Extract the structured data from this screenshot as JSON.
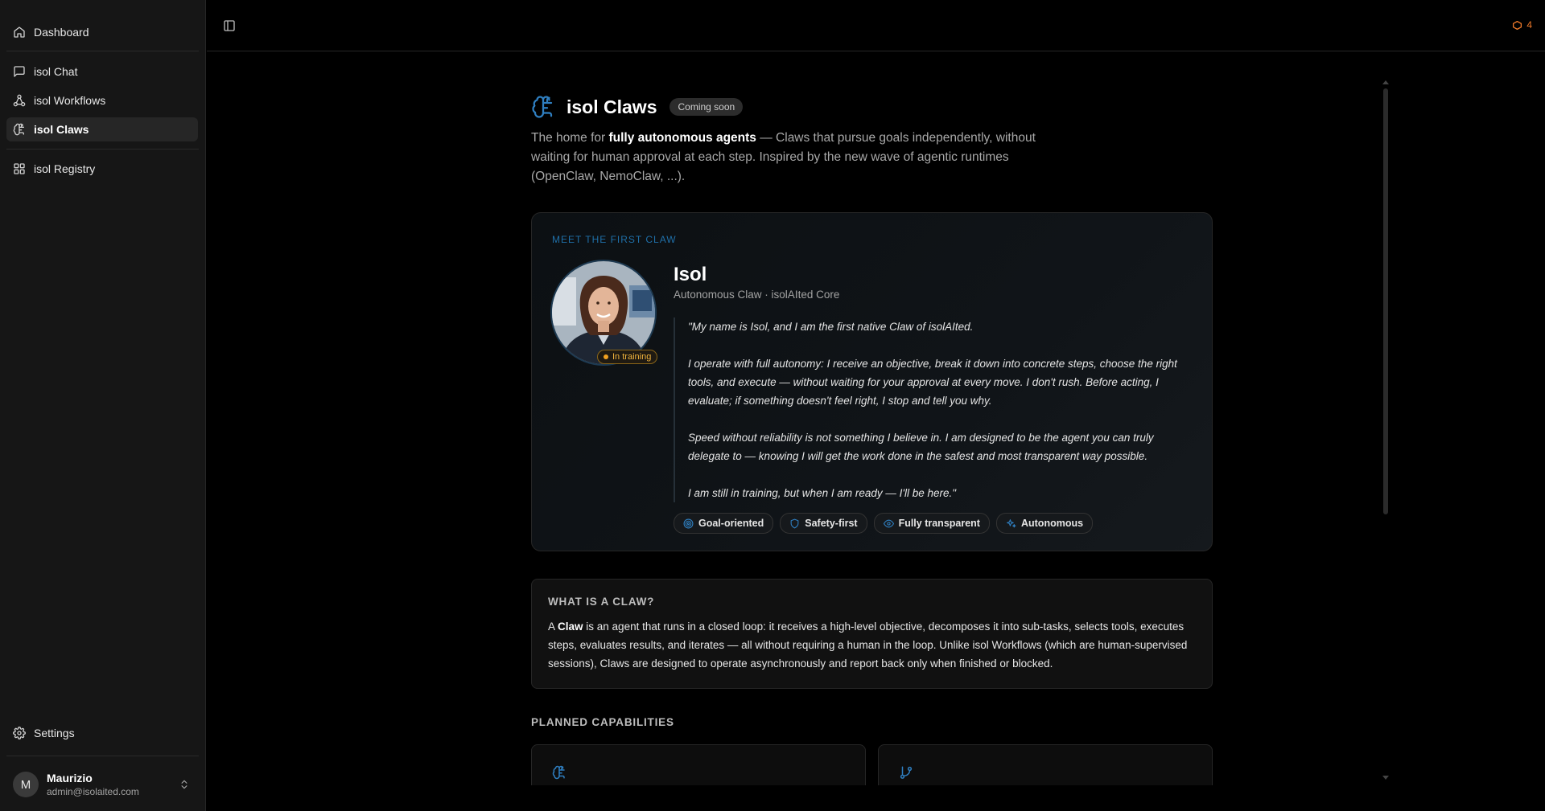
{
  "sidebar": {
    "items": [
      {
        "label": "Dashboard",
        "icon": "home-icon"
      },
      {
        "label": "isol Chat",
        "icon": "chat-icon"
      },
      {
        "label": "isol Workflows",
        "icon": "workflow-icon"
      },
      {
        "label": "isol Claws",
        "icon": "claw-icon",
        "active": true
      },
      {
        "label": "isol Registry",
        "icon": "grid-icon"
      }
    ],
    "settings_label": "Settings",
    "user": {
      "initial": "M",
      "name": "Maurizio",
      "email": "admin@isolaited.com"
    }
  },
  "topbar": {
    "alert_count": "4",
    "alert_color": "#f07a2a"
  },
  "page": {
    "title": "isol Claws",
    "badge": "Coming soon",
    "intro_prefix": "The home for ",
    "intro_bold": "fully autonomous agents",
    "intro_suffix": " — Claws that pursue goals independently, without waiting for human approval at each step. Inspired by the new wave of agentic runtimes (OpenClaw, NemoClaw, ...)."
  },
  "hero": {
    "eyebrow": "MEET THE FIRST CLAW",
    "status_badge": "In training",
    "name": "Isol",
    "role": "Autonomous Claw · isolAIted Core",
    "quote": [
      "\"My name is Isol, and I am the first native Claw of isolAIted.",
      "I operate with full autonomy: I receive an objective, break it down into concrete steps, choose the right tools, and execute — without waiting for your approval at every move. I don't rush. Before acting, I evaluate; if something doesn't feel right, I stop and tell you why.",
      "Speed without reliability is not something I believe in. I am designed to be the agent you can truly delegate to — knowing I will get the work done in the safest and most transparent way possible.",
      "I am still in training, but when I am ready — I'll be here.\""
    ],
    "tags": [
      {
        "label": "Goal-oriented",
        "icon": "target-icon"
      },
      {
        "label": "Safety-first",
        "icon": "shield-icon"
      },
      {
        "label": "Fully transparent",
        "icon": "eye-icon"
      },
      {
        "label": "Autonomous",
        "icon": "sparkles-icon"
      }
    ]
  },
  "whatis": {
    "title": "WHAT IS A CLAW?",
    "body_prefix": "A ",
    "body_bold": "Claw",
    "body_suffix": " is an agent that runs in a closed loop: it receives a high-level objective, decomposes it into sub-tasks, selects tools, executes steps, evaluates results, and iterates — all without requiring a human in the loop. Unlike isol Workflows (which are human-supervised sessions), Claws are designed to operate asynchronously and report back only when finished or blocked."
  },
  "capabilities": {
    "title": "PLANNED CAPABILITIES",
    "cards": [
      {
        "icon": "claw-icon"
      },
      {
        "icon": "git-branch-icon"
      }
    ]
  },
  "colors": {
    "accent": "#2f7fc1",
    "training": "#f0b33d"
  }
}
